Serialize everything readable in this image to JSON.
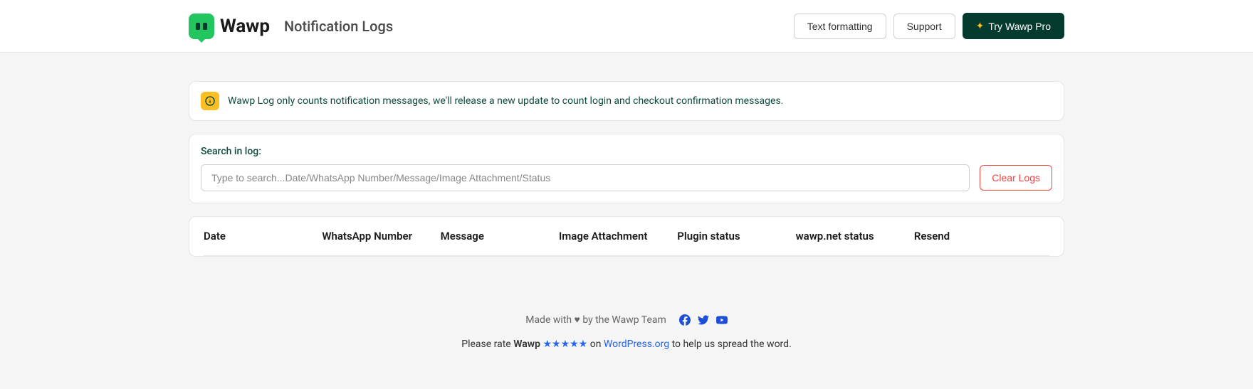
{
  "header": {
    "brand": "Wawp",
    "pageTitle": "Notification Logs",
    "buttons": {
      "textFormatting": "Text formatting",
      "support": "Support",
      "tryPro": "Try Wawp Pro"
    }
  },
  "alert": {
    "text": "Wawp Log only counts notification messages, we'll release a new update to count login and checkout confirmation messages."
  },
  "search": {
    "label": "Search in log:",
    "placeholder": "Type to search...Date/WhatsApp Number/Message/Image Attachment/Status",
    "clearButton": "Clear Logs"
  },
  "table": {
    "columns": {
      "date": "Date",
      "whatsapp": "WhatsApp Number",
      "message": "Message",
      "image": "Image Attachment",
      "plugin": "Plugin status",
      "wawp": "wawp.net status",
      "resend": "Resend"
    }
  },
  "footer": {
    "madeWith": "Made with ♥ by the Wawp Team",
    "rate": {
      "prefix": "Please rate ",
      "brand": "Wawp",
      "stars": " ★★★★★ ",
      "on": "on ",
      "wp": "WordPress.org",
      "suffix": " to help us spread the word."
    }
  }
}
